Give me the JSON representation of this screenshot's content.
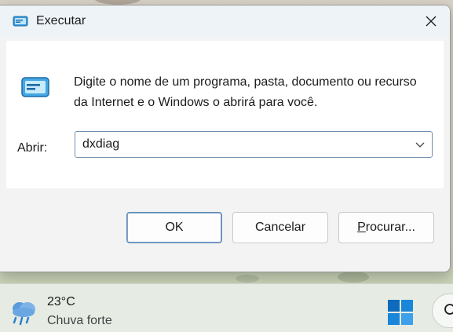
{
  "dialog": {
    "title": "Executar",
    "description": "Digite o nome de um programa, pasta, documento ou recurso da Internet e o Windows o abrirá para você.",
    "open_label": "Abrir:",
    "open_value": "dxdiag",
    "buttons": {
      "ok": "OK",
      "cancel": "Cancelar",
      "browse_accel": "P",
      "browse_rest": "rocurar..."
    },
    "icons": [
      "run-icon",
      "close-icon",
      "chevron-down-icon"
    ]
  },
  "taskbar": {
    "weather": {
      "temperature": "23°C",
      "condition": "Chuva forte",
      "icon": "rain-cloud-icon"
    },
    "icons": [
      "windows-start-icon",
      "search-icon"
    ]
  },
  "colors": {
    "accent": "#0067c0",
    "dialog_bg": "#f3f3f3",
    "content_bg": "#ffffff"
  }
}
